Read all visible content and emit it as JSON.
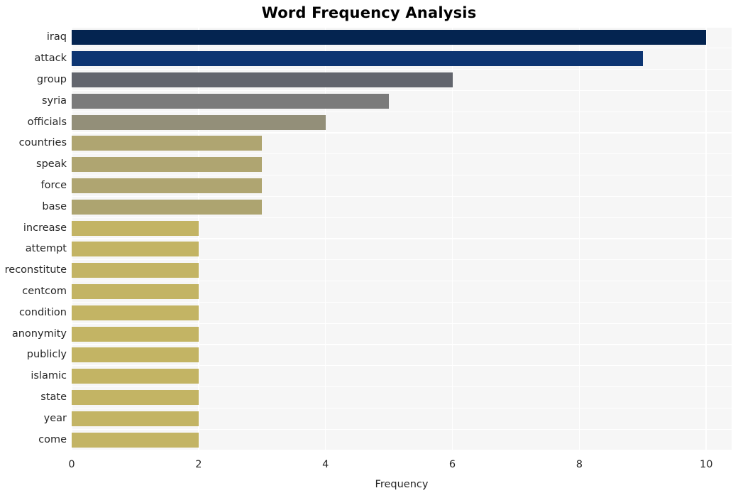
{
  "chart_data": {
    "type": "bar",
    "orientation": "horizontal",
    "title": "Word Frequency Analysis",
    "xlabel": "Frequency",
    "ylabel": "",
    "xlim": [
      0,
      10.4
    ],
    "ylim": [
      0,
      20
    ],
    "xticks": [
      "0",
      "2",
      "4",
      "6",
      "8",
      "10"
    ],
    "xtick_values": [
      0,
      2,
      4,
      6,
      8,
      10
    ],
    "grid": "white gridlines on light grey panel",
    "legend": "none",
    "categories": [
      "iraq",
      "attack",
      "group",
      "syria",
      "officials",
      "countries",
      "speak",
      "force",
      "base",
      "increase",
      "attempt",
      "reconstitute",
      "centcom",
      "condition",
      "anonymity",
      "publicly",
      "islamic",
      "state",
      "year",
      "come"
    ],
    "values": [
      10,
      9,
      6,
      5,
      4,
      3,
      3,
      3,
      3,
      2,
      2,
      2,
      2,
      2,
      2,
      2,
      2,
      2,
      2,
      2
    ],
    "bar_colors": [
      "#042450",
      "#0d3572",
      "#62656d",
      "#7b7b7b",
      "#938f79",
      "#afa571",
      "#afa571",
      "#afa571",
      "#ada470",
      "#c3b464",
      "#c3b464",
      "#c3b464",
      "#c3b464",
      "#c3b464",
      "#c3b464",
      "#c3b464",
      "#c3b464",
      "#c3b464",
      "#c3b464",
      "#c3b464"
    ],
    "colors": {
      "panel_background": "#f6f6f6",
      "figure_background": "#ffffff",
      "gridline": "#ffffff",
      "text": "#262626",
      "title": "#000000"
    }
  }
}
